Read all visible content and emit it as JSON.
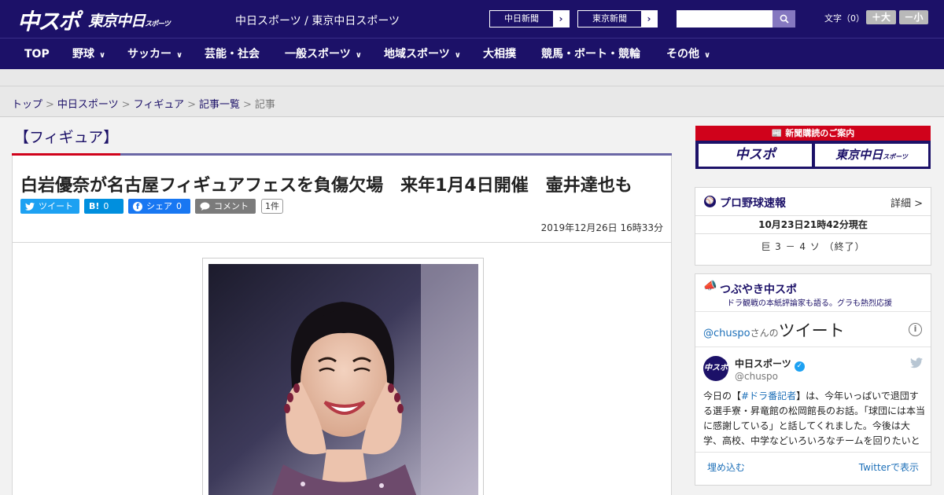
{
  "header": {
    "logo_main": "中スポ",
    "logo_tokyo": "東京中日",
    "logo_tokyo_small": "スポーツ",
    "site_title": "中日スポーツ / 東京中日スポーツ",
    "link_chunichi": "中日新聞",
    "link_tokyo": "東京新聞",
    "search_placeholder": "",
    "font_size_label": "文字（0）",
    "font_increase": "＋大",
    "font_decrease": "－小"
  },
  "nav": {
    "items": [
      {
        "label": "TOP"
      },
      {
        "label": "野球"
      },
      {
        "label": "サッカー"
      },
      {
        "label": "芸能・社会"
      },
      {
        "label": "一般スポーツ"
      },
      {
        "label": "地域スポーツ"
      },
      {
        "label": "大相撲"
      },
      {
        "label": "競馬・ボート・競輪"
      },
      {
        "label": "その他"
      }
    ]
  },
  "breadcrumb": {
    "items": [
      "トップ",
      "中日スポーツ",
      "フィギュア",
      "記事一覧",
      "記事"
    ],
    "separator": ">"
  },
  "article": {
    "category": "【フィギュア】",
    "headline": "白岩優奈が名古屋フィギュアフェスを負傷欠場　来年1月4日開催　壷井達也も",
    "share": {
      "tweet_label": "ツイート",
      "hatena_label": "B!",
      "hatena_count": "0",
      "facebook_label": "シェア",
      "facebook_count": "0",
      "comment_label": "コメント",
      "comment_count": "1件"
    },
    "published": "2019年12月26日 16時33分"
  },
  "sidebar": {
    "subscribe": {
      "title": "新聞購読のご案内",
      "chuspo": "中スポ",
      "tokyo": "東京中日",
      "tokyo_small": "スポーツ"
    },
    "baseball": {
      "title": "プロ野球速報",
      "detail": "詳細 >",
      "as_of": "10月23日21時42分現在",
      "score": "巨  3  －  4  ソ  （終了）"
    },
    "tweets": {
      "title": "つぶやき中スポ",
      "subtitle": "ドラ観戦の本紙評論家も語る。グラも熱烈応援",
      "handle_prefix": "@chuspo",
      "handle_suffix": "さんの",
      "heading": "ツイート",
      "account_name": "中日スポーツ",
      "account_handle": "@chuspo",
      "text_before": "今日の【",
      "text_tag": "#ドラ番記者",
      "text_after": "】は、今年いっぱいで退団する選手寮・昇竜館の松岡館長のお話。「球団には本当に感謝している」と話してくれました。今後は大学、高校、中学などいろいろなチームを回りたいと",
      "embed": "埋め込む",
      "view_on_twitter": "Twitterで表示"
    }
  },
  "colors": {
    "brand_navy": "#1c1168",
    "accent_red": "#d0021b",
    "twitter_blue": "#1da1f2",
    "facebook_blue": "#1877f2",
    "hatena_blue": "#008fde",
    "comment_gray": "#7b7b7b"
  }
}
